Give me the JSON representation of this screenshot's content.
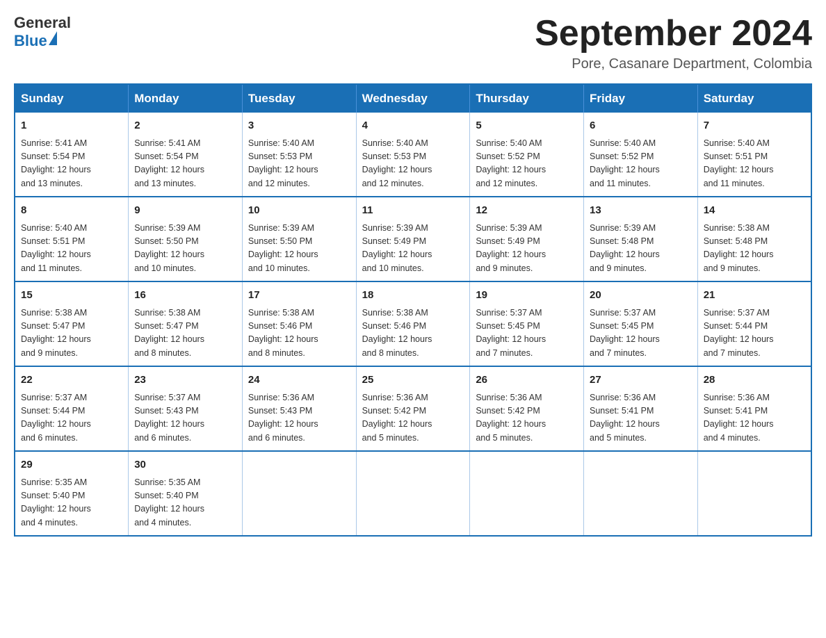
{
  "logo": {
    "text_general": "General",
    "text_blue": "Blue"
  },
  "title": "September 2024",
  "subtitle": "Pore, Casanare Department, Colombia",
  "days_of_week": [
    "Sunday",
    "Monday",
    "Tuesday",
    "Wednesday",
    "Thursday",
    "Friday",
    "Saturday"
  ],
  "weeks": [
    [
      {
        "day": "1",
        "sunrise": "5:41 AM",
        "sunset": "5:54 PM",
        "daylight": "12 hours and 13 minutes."
      },
      {
        "day": "2",
        "sunrise": "5:41 AM",
        "sunset": "5:54 PM",
        "daylight": "12 hours and 13 minutes."
      },
      {
        "day": "3",
        "sunrise": "5:40 AM",
        "sunset": "5:53 PM",
        "daylight": "12 hours and 12 minutes."
      },
      {
        "day": "4",
        "sunrise": "5:40 AM",
        "sunset": "5:53 PM",
        "daylight": "12 hours and 12 minutes."
      },
      {
        "day": "5",
        "sunrise": "5:40 AM",
        "sunset": "5:52 PM",
        "daylight": "12 hours and 12 minutes."
      },
      {
        "day": "6",
        "sunrise": "5:40 AM",
        "sunset": "5:52 PM",
        "daylight": "12 hours and 11 minutes."
      },
      {
        "day": "7",
        "sunrise": "5:40 AM",
        "sunset": "5:51 PM",
        "daylight": "12 hours and 11 minutes."
      }
    ],
    [
      {
        "day": "8",
        "sunrise": "5:40 AM",
        "sunset": "5:51 PM",
        "daylight": "12 hours and 11 minutes."
      },
      {
        "day": "9",
        "sunrise": "5:39 AM",
        "sunset": "5:50 PM",
        "daylight": "12 hours and 10 minutes."
      },
      {
        "day": "10",
        "sunrise": "5:39 AM",
        "sunset": "5:50 PM",
        "daylight": "12 hours and 10 minutes."
      },
      {
        "day": "11",
        "sunrise": "5:39 AM",
        "sunset": "5:49 PM",
        "daylight": "12 hours and 10 minutes."
      },
      {
        "day": "12",
        "sunrise": "5:39 AM",
        "sunset": "5:49 PM",
        "daylight": "12 hours and 9 minutes."
      },
      {
        "day": "13",
        "sunrise": "5:39 AM",
        "sunset": "5:48 PM",
        "daylight": "12 hours and 9 minutes."
      },
      {
        "day": "14",
        "sunrise": "5:38 AM",
        "sunset": "5:48 PM",
        "daylight": "12 hours and 9 minutes."
      }
    ],
    [
      {
        "day": "15",
        "sunrise": "5:38 AM",
        "sunset": "5:47 PM",
        "daylight": "12 hours and 9 minutes."
      },
      {
        "day": "16",
        "sunrise": "5:38 AM",
        "sunset": "5:47 PM",
        "daylight": "12 hours and 8 minutes."
      },
      {
        "day": "17",
        "sunrise": "5:38 AM",
        "sunset": "5:46 PM",
        "daylight": "12 hours and 8 minutes."
      },
      {
        "day": "18",
        "sunrise": "5:38 AM",
        "sunset": "5:46 PM",
        "daylight": "12 hours and 8 minutes."
      },
      {
        "day": "19",
        "sunrise": "5:37 AM",
        "sunset": "5:45 PM",
        "daylight": "12 hours and 7 minutes."
      },
      {
        "day": "20",
        "sunrise": "5:37 AM",
        "sunset": "5:45 PM",
        "daylight": "12 hours and 7 minutes."
      },
      {
        "day": "21",
        "sunrise": "5:37 AM",
        "sunset": "5:44 PM",
        "daylight": "12 hours and 7 minutes."
      }
    ],
    [
      {
        "day": "22",
        "sunrise": "5:37 AM",
        "sunset": "5:44 PM",
        "daylight": "12 hours and 6 minutes."
      },
      {
        "day": "23",
        "sunrise": "5:37 AM",
        "sunset": "5:43 PM",
        "daylight": "12 hours and 6 minutes."
      },
      {
        "day": "24",
        "sunrise": "5:36 AM",
        "sunset": "5:43 PM",
        "daylight": "12 hours and 6 minutes."
      },
      {
        "day": "25",
        "sunrise": "5:36 AM",
        "sunset": "5:42 PM",
        "daylight": "12 hours and 5 minutes."
      },
      {
        "day": "26",
        "sunrise": "5:36 AM",
        "sunset": "5:42 PM",
        "daylight": "12 hours and 5 minutes."
      },
      {
        "day": "27",
        "sunrise": "5:36 AM",
        "sunset": "5:41 PM",
        "daylight": "12 hours and 5 minutes."
      },
      {
        "day": "28",
        "sunrise": "5:36 AM",
        "sunset": "5:41 PM",
        "daylight": "12 hours and 4 minutes."
      }
    ],
    [
      {
        "day": "29",
        "sunrise": "5:35 AM",
        "sunset": "5:40 PM",
        "daylight": "12 hours and 4 minutes."
      },
      {
        "day": "30",
        "sunrise": "5:35 AM",
        "sunset": "5:40 PM",
        "daylight": "12 hours and 4 minutes."
      },
      null,
      null,
      null,
      null,
      null
    ]
  ],
  "labels": {
    "sunrise_prefix": "Sunrise: ",
    "sunset_prefix": "Sunset: ",
    "daylight_prefix": "Daylight: "
  }
}
